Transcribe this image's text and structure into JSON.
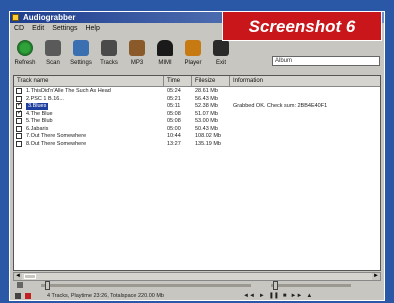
{
  "window": {
    "title": "Audiograbber"
  },
  "menu": [
    "CD",
    "Edit",
    "Settings",
    "Help"
  ],
  "banner": "Screenshot 6",
  "toolbar": {
    "buttons": [
      {
        "label": "Refresh",
        "icon": "refresh-icon"
      },
      {
        "label": "Scan",
        "icon": "scan-icon"
      },
      {
        "label": "Settings",
        "icon": "settings-icon"
      },
      {
        "label": "Tracks",
        "icon": "tracks-icon"
      },
      {
        "label": "MP3",
        "icon": "mp3-icon"
      },
      {
        "label": "MIMI",
        "icon": "mimi-icon"
      },
      {
        "label": "Player",
        "icon": "player-icon"
      },
      {
        "label": "Exit",
        "icon": "exit-icon"
      }
    ],
    "album_field": "Album"
  },
  "list": {
    "columns": [
      "Track name",
      "Time",
      "Filesize",
      "Information"
    ],
    "rows": [
      {
        "checked": false,
        "name": "1.ThisDid'n'Alle The Such As Head",
        "time": "05:24",
        "size": "28.61 Mb",
        "info": ""
      },
      {
        "checked": false,
        "name": "2.PSC 1 B.16...",
        "time": "05:21",
        "size": "56.43 Mb",
        "info": ""
      },
      {
        "checked": true,
        "name": "3.Blues",
        "time": "05:11",
        "size": "52.38 Mb",
        "info": "Grabbed OK. Check sum: 2BB4E40F1",
        "selected": true
      },
      {
        "checked": true,
        "name": "4.The Blue",
        "time": "05:08",
        "size": "51.07 Mb",
        "info": ""
      },
      {
        "checked": false,
        "name": "5.The Blub",
        "time": "05:08",
        "size": "53.00 Mb",
        "info": ""
      },
      {
        "checked": false,
        "name": "6.Jabaris",
        "time": "05:00",
        "size": "50.43 Mb",
        "info": ""
      },
      {
        "checked": false,
        "name": "7.Out There Somewhere",
        "time": "10:44",
        "size": "108.02 Mb",
        "info": ""
      },
      {
        "checked": false,
        "name": "8.Out There Somewhere",
        "time": "13:27",
        "size": "135.19 Mb",
        "info": ""
      }
    ]
  },
  "status": {
    "text": "4 Tracks, Playtime 23:26, Totalspace 220.00 Mb"
  }
}
